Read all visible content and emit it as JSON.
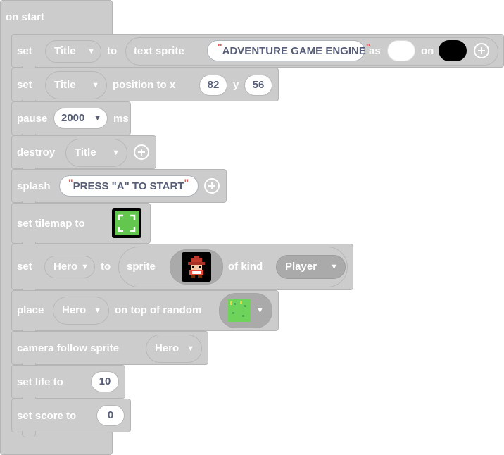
{
  "on_start": {
    "label": "on start"
  },
  "set_text_sprite": {
    "set_label": "set",
    "variable": "Title",
    "to_label": "to",
    "text_sprite_label": "text sprite",
    "text_value": "ADVENTURE GAME ENGINE",
    "as_label": "as",
    "on_label": "on",
    "as_color": "#ffffff",
    "on_color": "#000000"
  },
  "set_position": {
    "set_label": "set",
    "variable": "Title",
    "position_label": "position to x",
    "x_value": "82",
    "y_label": "y",
    "y_value": "56"
  },
  "pause": {
    "label": "pause",
    "value": "2000",
    "unit": "ms"
  },
  "destroy": {
    "label": "destroy",
    "variable": "Title"
  },
  "splash": {
    "label": "splash",
    "text": "PRESS \"A\" TO START"
  },
  "set_tilemap": {
    "label": "set tilemap to"
  },
  "set_sprite": {
    "set_label": "set",
    "variable": "Hero",
    "to_label": "to",
    "sprite_label": "sprite",
    "of_kind_label": "of kind",
    "kind": "Player"
  },
  "place": {
    "label": "place",
    "variable": "Hero",
    "on_top_label": "on top of random"
  },
  "camera": {
    "label": "camera follow sprite",
    "variable": "Hero"
  },
  "set_life": {
    "label": "set life to",
    "value": "10"
  },
  "set_score": {
    "label": "set score to",
    "value": "0"
  },
  "colors": {
    "block": "#cccccc",
    "block_border": "#b5b5b5",
    "dark_reporter": "#aaaaaa",
    "string_quote": "#e45a5a",
    "value_text": "#575e75"
  }
}
